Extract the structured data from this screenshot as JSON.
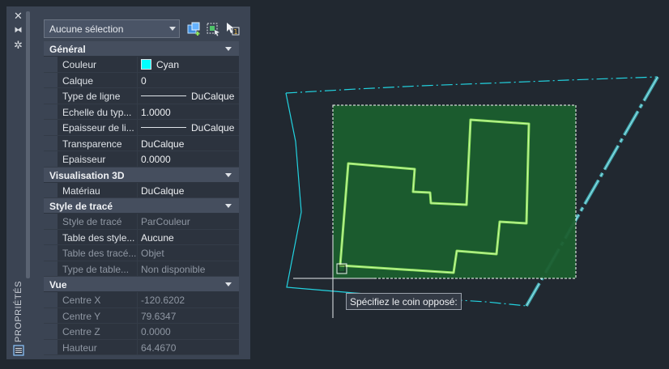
{
  "palette": {
    "title": "PROPRIÉTÉS",
    "selection": "Aucune sélection",
    "categories": [
      {
        "name": "Général",
        "rows": [
          {
            "label": "Couleur",
            "value": "Cyan"
          },
          {
            "label": "Calque",
            "value": "0"
          },
          {
            "label": "Type de ligne",
            "value": "DuCalque"
          },
          {
            "label": "Echelle du typ...",
            "value": "1.0000"
          },
          {
            "label": "Epaisseur de li...",
            "value": "DuCalque"
          },
          {
            "label": "Transparence",
            "value": "DuCalque"
          },
          {
            "label": "Epaisseur",
            "value": "0.0000"
          }
        ]
      },
      {
        "name": "Visualisation 3D",
        "rows": [
          {
            "label": "Matériau",
            "value": "DuCalque"
          }
        ]
      },
      {
        "name": "Style de tracé",
        "rows": [
          {
            "label": "Style de tracé",
            "value": "ParCouleur"
          },
          {
            "label": "Table des style...",
            "value": "Aucune"
          },
          {
            "label": "Table des tracé...",
            "value": "Objet"
          },
          {
            "label": "Type de table...",
            "value": "Non disponible"
          }
        ]
      },
      {
        "name": "Vue",
        "rows": [
          {
            "label": "Centre X",
            "value": "-120.6202"
          },
          {
            "label": "Centre Y",
            "value": "79.6347"
          },
          {
            "label": "Centre Z",
            "value": "0.0000"
          },
          {
            "label": "Hauteur",
            "value": "64.4670"
          }
        ]
      }
    ]
  },
  "colors": {
    "swatch_cyan": "#00ffff",
    "selection_fill": "#1b5e2e",
    "polyline": "#8de35a",
    "canvas_bg": "#212830"
  },
  "icons": [
    "close-icon",
    "autohide-icon",
    "settings-icon",
    "quick-select-icon",
    "select-objects-icon",
    "pickadd-toggle-icon",
    "properties-palette-icon"
  ],
  "canvas": {
    "prompt": "Spécifiez le coin opposé:"
  }
}
